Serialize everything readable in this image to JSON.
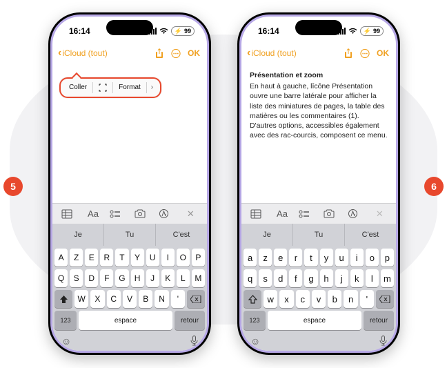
{
  "status": {
    "time": "16:14",
    "battery": "99"
  },
  "nav": {
    "back_chevron": "‹",
    "back_label": "iCloud (tout)",
    "ok": "OK"
  },
  "context_menu": {
    "paste": "Coller",
    "format": "Format"
  },
  "note": {
    "title": "Présentation et zoom",
    "body": "En haut à gauche, lîcône Présentation ouvre une barre latérale pour afficher la liste des miniatures de pages, la table des matières ou les commentaires (1). D'autres options, accessibles également avec des rac-courcis, composent ce menu."
  },
  "format_bar": {
    "aa": "Aa"
  },
  "suggestions": [
    "Je",
    "Tu",
    "C'est"
  ],
  "keys_upper": {
    "r1": [
      "A",
      "Z",
      "E",
      "R",
      "T",
      "Y",
      "U",
      "I",
      "O",
      "P"
    ],
    "r2": [
      "Q",
      "S",
      "D",
      "F",
      "G",
      "H",
      "J",
      "K",
      "L",
      "M"
    ],
    "r3": [
      "W",
      "X",
      "C",
      "V",
      "B",
      "N"
    ]
  },
  "keys_lower": {
    "r1": [
      "a",
      "z",
      "e",
      "r",
      "t",
      "y",
      "u",
      "i",
      "o",
      "p"
    ],
    "r2": [
      "q",
      "s",
      "d",
      "f",
      "g",
      "h",
      "j",
      "k",
      "l",
      "m"
    ],
    "r3": [
      "w",
      "x",
      "c",
      "v",
      "b",
      "n"
    ]
  },
  "bottom": {
    "num": "123",
    "space": "espace",
    "return": "retour"
  },
  "badges": {
    "five": "5",
    "six": "6"
  }
}
